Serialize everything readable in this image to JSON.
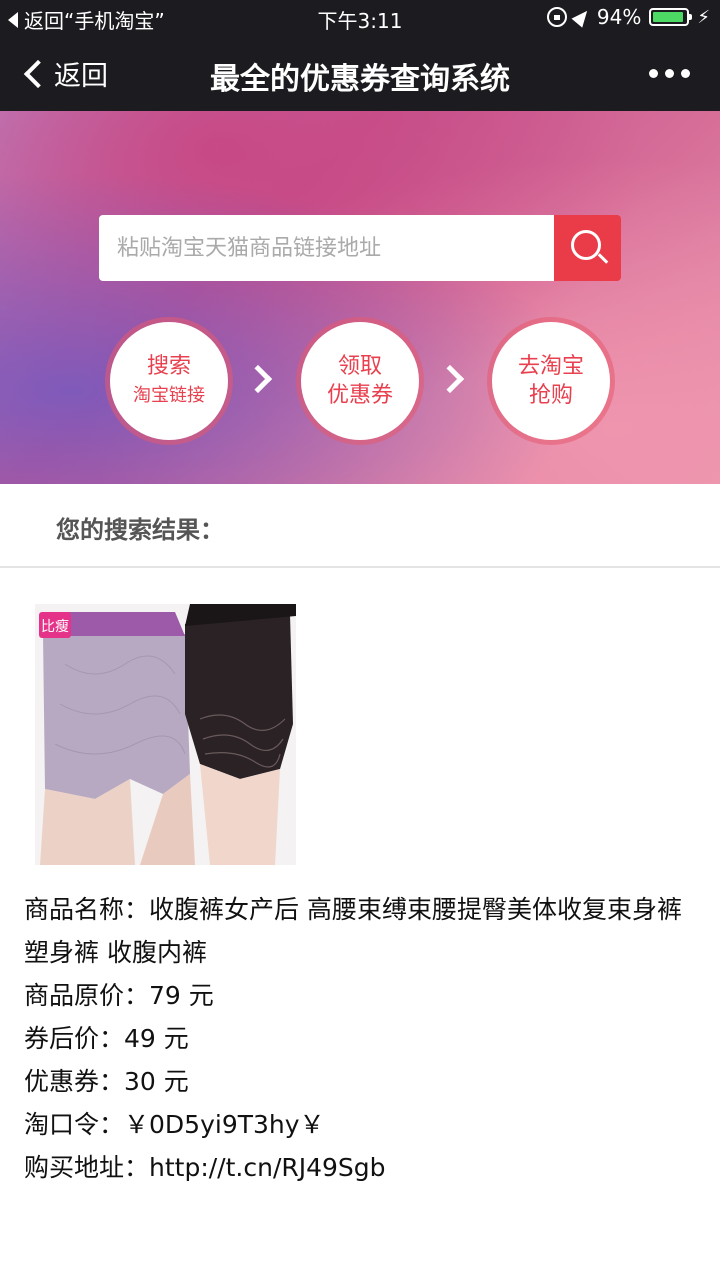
{
  "status_bar": {
    "back_app": "返回“手机淘宝”",
    "time": "下午3:11",
    "battery": "94%",
    "battery_level": 0.94
  },
  "nav": {
    "back_label": "返回",
    "title": "最全的优惠券查询系统"
  },
  "search": {
    "placeholder": "粘贴淘宝天猫商品链接地址"
  },
  "steps": [
    {
      "line1": "搜索",
      "line2": "淘宝链接"
    },
    {
      "line1": "领取",
      "line2": "优惠券"
    },
    {
      "line1": "去淘宝",
      "line2": "抢购"
    }
  ],
  "result": {
    "header": "您的搜索结果：",
    "image_logo": "比瘦",
    "name_label": "商品名称：",
    "name": "收腹裤女产后 高腰束缚束腰提臀美体收复束身裤 塑身裤 收腹内裤",
    "price_label": "商品原价：",
    "price": "79 元",
    "after_label": "券后价：",
    "after": "49 元",
    "coupon_label": "优惠券：",
    "coupon": "30 元",
    "tkl_label": "淘口令：",
    "tkl": "￥0D5yi9T3hy￥",
    "url_label": "购买地址：",
    "url": "http://t.cn/RJ49Sgb"
  }
}
